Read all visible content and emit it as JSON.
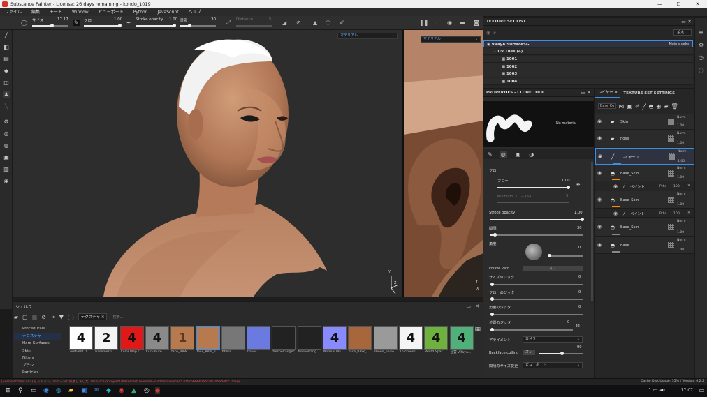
{
  "window": {
    "title": "Substance Painter - License: 26 days remaining - kondo_1019",
    "min": "—",
    "max": "☐",
    "close": "✕"
  },
  "menu": [
    "ファイル",
    "編集",
    "モード",
    "Window",
    "ビューポート",
    "Python",
    "JavaScript",
    "ヘルプ"
  ],
  "toolopts": {
    "size_label": "サイズ",
    "size_value": "17.17",
    "size_pct": 0.55,
    "flow_label": "フロー",
    "flow_value": "1.00",
    "flow_pct": 1.0,
    "opacity_label": "Stroke opacity",
    "opacity_value": "1.00",
    "opacity_pct": 1.0,
    "spacing_label": "間隔",
    "spacing_value": "30",
    "spacing_pct": 0.28,
    "distance_label": "Distance",
    "distance_value": "5"
  },
  "viewport": {
    "left_select": "マテリアル",
    "right_select": "マテリアル",
    "axis_y": "Y",
    "axis_z": "Z",
    "axis_x": "X"
  },
  "shelf": {
    "title": "シェルフ",
    "tab": "テクスチャ",
    "search_placeholder": "検索...",
    "categories": [
      "Procedurals",
      "テクスチャ",
      "Hard Surfaces",
      "Skin",
      "Filters",
      "ブラシ",
      "Particles"
    ],
    "selected_category": 1,
    "items": [
      {
        "label": "Ambient O...",
        "num": "4",
        "bg": "#ffffff",
        "fg": "#111111"
      },
      {
        "label": "basemesh",
        "num": "2",
        "bg": "#f4f4f4",
        "fg": "#111111"
      },
      {
        "label": "Color Map f...",
        "num": "4",
        "bg": "#e01818",
        "fg": "#111111"
      },
      {
        "label": "Curvature ...",
        "num": "4",
        "bg": "#8a8a8a",
        "fg": "#111111"
      },
      {
        "label": "face_RAW",
        "num": "1",
        "bg": "#b7794e",
        "fg": "#5a3a20"
      },
      {
        "label": "face_RAW_1...",
        "num": "",
        "bg": "#b7794e",
        "fg": "#5a3a20"
      },
      {
        "label": "fibers",
        "num": "",
        "bg": "#777777",
        "fg": "#111111"
      },
      {
        "label": "flakes",
        "num": "",
        "bg": "#6a7ae0",
        "fg": "#111111"
      },
      {
        "label": "fresnelrangec",
        "num": "",
        "bg": "#222222",
        "fg": "#eeeeee"
      },
      {
        "label": "fresnelrang...",
        "num": "",
        "bg": "#222222",
        "fg": "#eeeeee"
      },
      {
        "label": "Normal Ma...",
        "num": "4",
        "bg": "#8a8aff",
        "fg": "#111111"
      },
      {
        "label": "face_RAW_...",
        "num": "",
        "bg": "#a8663d",
        "fg": "#111111"
      },
      {
        "label": "sheen_noise",
        "num": "",
        "bg": "#9a9a9a",
        "fg": "#111111"
      },
      {
        "label": "Thickness ...",
        "num": "4",
        "bg": "#f4f4f4",
        "fg": "#111111"
      },
      {
        "label": "World Spac...",
        "num": "4",
        "bg": "#6fb13d",
        "fg": "#111111"
      },
      {
        "label": "位置 VRayA...",
        "num": "4",
        "bg": "#4fb07a",
        "fg": "#111111"
      }
    ]
  },
  "texture_set_list": {
    "title": "TEXTURE SET LIST",
    "settings": "設定",
    "material": "VRayAlSurfaceSG",
    "shader": "Main shader",
    "uv_tiles": "UV Tiles (4)",
    "tiles": [
      "1001",
      "1002",
      "1003",
      "1004"
    ]
  },
  "properties": {
    "title": "PROPERTIES - CLONE TOOL",
    "no_material": "No material",
    "section": "フロー",
    "flow_label": "フロー",
    "flow_value": "1.00",
    "flow_pct": 1.0,
    "min_flow_label": "Minimum フロー (%)",
    "min_flow_value": "5",
    "opacity_label": "Stroke opacity",
    "opacity_value": "1.00",
    "opacity_pct": 1.0,
    "spacing_label": "間隔",
    "spacing_value": "30",
    "spacing_pct": 0.05,
    "angle_label": "角度",
    "angle_value": "0",
    "follow_path_label": "Follow Path",
    "follow_path_value": "オフ",
    "size_jitter_label": "サイズのジッタ",
    "size_jitter_value": "0",
    "flow_jitter_label": "フローのジッタ",
    "flow_jitter_value": "0",
    "angle_jitter_label": "角度のジッタ",
    "angle_jitter_value": "0",
    "pos_jitter_label": "位置のジッタ",
    "pos_jitter_value": "0",
    "alignment_label": "アライメント",
    "alignment_value": "カメラ",
    "backface_label": "Backface culling",
    "backface_value": "オン",
    "backface_num": "90",
    "spacing_change_label": "間隔のサイズ変更",
    "spacing_change_value": "ビューポート"
  },
  "layers": {
    "tab1": "レイヤー",
    "tab2": "TEXTURE SET SETTINGS",
    "blend": "Base Co",
    "items": [
      {
        "name": "Skin",
        "type": "folder",
        "norm": "Norm",
        "op": "1.00"
      },
      {
        "name": "nose",
        "type": "folder",
        "norm": "Norm",
        "op": "1.00"
      },
      {
        "name": "レイヤー 1",
        "type": "paint",
        "norm": "Norm",
        "op": "1.00"
      },
      {
        "name": "Base_Skin",
        "type": "fill",
        "norm": "Norm",
        "op": "1.00"
      },
      {
        "name": "Base_Skin",
        "type": "fill",
        "norm": "Norm",
        "op": "1.00"
      },
      {
        "name": "Base_Skin",
        "type": "fill",
        "norm": "Norm",
        "op": "1.00"
      },
      {
        "name": "Base",
        "type": "fill",
        "norm": "Norm",
        "op": "1.00"
      }
    ],
    "sub_paint": "ペイント",
    "sub_mode": "Pthr",
    "sub_op": "100"
  },
  "status": {
    "error": "[SceneBitmapLoad] ビットマップのデータに失敗しました: resource://project1/basemesh?version=e3dd9a0ce9b7e5304756b6b2a5cd0205ed4fcc.image",
    "cache": "Cache Disk Usage:   35% | Version: 6.2.2"
  },
  "taskbar": {
    "time": "17:07"
  },
  "colors": {
    "accent": "#3d8fe6",
    "orange": "#ff8a00",
    "skin": "#c58a66"
  }
}
